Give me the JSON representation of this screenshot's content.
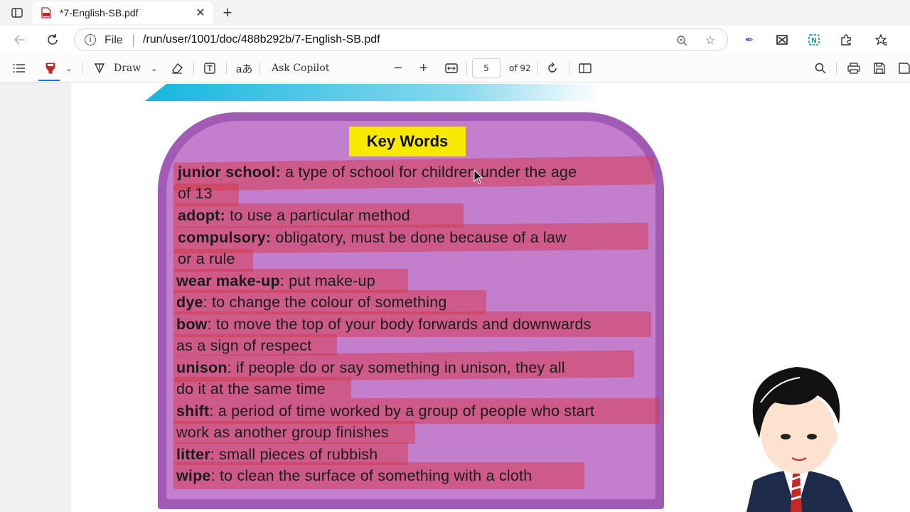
{
  "browser": {
    "tab_title": "*7-English-SB.pdf",
    "address_label": "File",
    "url": "/run/user/1001/doc/488b292b/7-English-SB.pdf"
  },
  "pdf_toolbar": {
    "draw_label": "Draw",
    "ask_copilot_label": "Ask Copilot",
    "page_number": "5",
    "page_count": "of 92"
  },
  "document": {
    "title": "Key Words",
    "entries": [
      {
        "term": "junior school:",
        "definition": " a type of school for children under the age"
      },
      {
        "term": "",
        "definition": "of 13"
      },
      {
        "term": "adopt:",
        "definition": " to use a particular method"
      },
      {
        "term": "compulsory:",
        "definition": "  obligatory, must be done because of a law"
      },
      {
        "term": "",
        "definition": "or a rule"
      },
      {
        "term": "wear make-up",
        "definition": ": put make-up"
      },
      {
        "term": "dye",
        "definition": ": to change the colour of something"
      },
      {
        "term": "bow",
        "definition": ": to move the top of your body forwards and downwards"
      },
      {
        "term": "",
        "definition": "as a sign of respect"
      },
      {
        "term": "unison",
        "definition": ": if people do or say something in unison, they all"
      },
      {
        "term": "",
        "definition": "do it at the same time"
      },
      {
        "term": "shift",
        "definition": ": a period of time worked by a group of people who start"
      },
      {
        "term": "",
        "definition": "work as another group finishes"
      },
      {
        "term": "litter",
        "definition": ": small pieces of rubbish"
      },
      {
        "term": "wipe",
        "definition": ": to clean the surface of something with a cloth"
      }
    ]
  },
  "colors": {
    "card_outer": "#a15bb5",
    "card_inner": "#c37fcd",
    "title_bg": "#f7ea00",
    "highlight": "#d63c50",
    "accent": "#1a73e8"
  }
}
